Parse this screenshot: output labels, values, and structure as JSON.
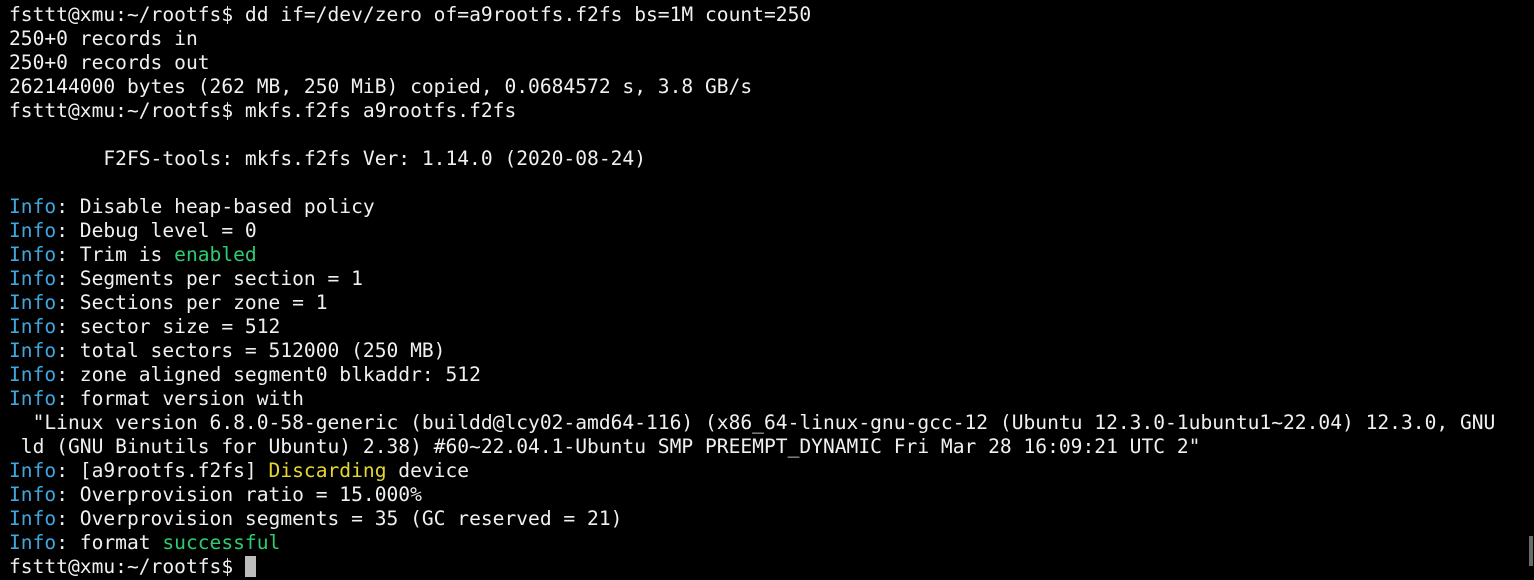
{
  "terminal": {
    "prompt": "fsttt@xmu:~/rootfs$",
    "lines": [
      {
        "type": "prompt",
        "cmd": "dd if=/dev/zero of=a9rootfs.f2fs bs=1M count=250"
      },
      {
        "type": "text",
        "text": "250+0 records in"
      },
      {
        "type": "text",
        "text": "250+0 records out"
      },
      {
        "type": "text",
        "text": "262144000 bytes (262 MB, 250 MiB) copied, 0.0684572 s, 3.8 GB/s"
      },
      {
        "type": "prompt",
        "cmd": "mkfs.f2fs a9rootfs.f2fs"
      },
      {
        "type": "text",
        "text": ""
      },
      {
        "type": "text",
        "text": "        F2FS-tools: mkfs.f2fs Ver: 1.14.0 (2020-08-24)"
      },
      {
        "type": "text",
        "text": ""
      },
      {
        "type": "info",
        "parts": [
          {
            "t": "Disable heap-based policy"
          }
        ]
      },
      {
        "type": "info",
        "parts": [
          {
            "t": "Debug level = 0"
          }
        ]
      },
      {
        "type": "info",
        "parts": [
          {
            "t": "Trim is "
          },
          {
            "t": "enabled",
            "c": "green"
          }
        ]
      },
      {
        "type": "info",
        "parts": [
          {
            "t": "Segments per section = 1"
          }
        ]
      },
      {
        "type": "info",
        "parts": [
          {
            "t": "Sections per zone = 1"
          }
        ]
      },
      {
        "type": "info",
        "parts": [
          {
            "t": "sector size = 512"
          }
        ]
      },
      {
        "type": "info",
        "parts": [
          {
            "t": "total sectors = 512000 (250 MB)"
          }
        ]
      },
      {
        "type": "info",
        "parts": [
          {
            "t": "zone aligned segment0 blkaddr: 512"
          }
        ]
      },
      {
        "type": "info",
        "parts": [
          {
            "t": "format version with"
          }
        ]
      },
      {
        "type": "text",
        "text": "  \"Linux version 6.8.0-58-generic (buildd@lcy02-amd64-116) (x86_64-linux-gnu-gcc-12 (Ubuntu 12.3.0-1ubuntu1~22.04) 12.3.0, GNU"
      },
      {
        "type": "text",
        "text": " ld (GNU Binutils for Ubuntu) 2.38) #60~22.04.1-Ubuntu SMP PREEMPT_DYNAMIC Fri Mar 28 16:09:21 UTC 2\""
      },
      {
        "type": "info",
        "parts": [
          {
            "t": "[a9rootfs.f2fs] "
          },
          {
            "t": "Discarding",
            "c": "yellow"
          },
          {
            "t": " device"
          }
        ]
      },
      {
        "type": "info",
        "parts": [
          {
            "t": "Overprovision ratio = 15.000%"
          }
        ]
      },
      {
        "type": "info",
        "parts": [
          {
            "t": "Overprovision segments = 35 (GC reserved = 21)"
          }
        ]
      },
      {
        "type": "info",
        "parts": [
          {
            "t": "format "
          },
          {
            "t": "successful",
            "c": "green"
          }
        ]
      },
      {
        "type": "prompt",
        "cmd": "",
        "cursor": true
      }
    ],
    "info_label": "Info",
    "colors": {
      "background": "#000000",
      "foreground": "#f0f0f0",
      "info": "#3fa7e0",
      "green": "#2ecc71",
      "yellow": "#e5d632"
    }
  }
}
